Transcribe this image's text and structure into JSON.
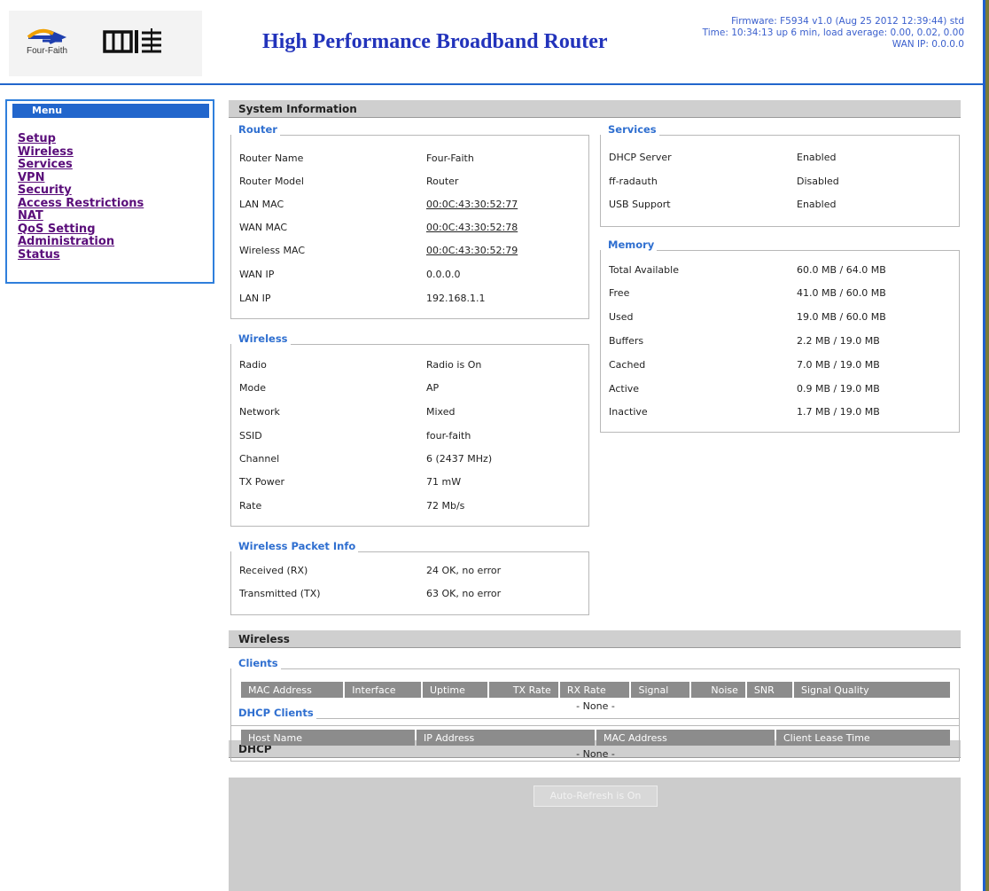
{
  "header": {
    "logo_text": "Four-Faith",
    "title": "High Performance Broadband Router",
    "firmware": "Firmware: F5934 v1.0 (Aug 25 2012 12:39:44) std",
    "time": "Time: 10:34:13 up 6 min, load average: 0.00, 0.02, 0.00",
    "wan_ip": "WAN IP: 0.0.0.0"
  },
  "menu": {
    "title": "Menu",
    "items": [
      "Setup",
      "Wireless",
      "Services",
      "VPN",
      "Security",
      "Access Restrictions",
      "NAT",
      "QoS Setting",
      "Administration",
      "Status"
    ]
  },
  "sections": {
    "system_info": "System Information",
    "wireless": "Wireless",
    "dhcp": "DHCP"
  },
  "router": {
    "legend": "Router",
    "rows": [
      {
        "label": "Router Name",
        "value": "Four-Faith"
      },
      {
        "label": "Router Model",
        "value": "Router"
      },
      {
        "label": "LAN MAC",
        "value": "00:0C:43:30:52:77"
      },
      {
        "label": "WAN MAC",
        "value": "00:0C:43:30:52:78"
      },
      {
        "label": "Wireless MAC",
        "value": "00:0C:43:30:52:79"
      },
      {
        "label": "WAN IP",
        "value": "0.0.0.0"
      },
      {
        "label": "LAN IP",
        "value": "192.168.1.1"
      }
    ]
  },
  "wireless_info": {
    "legend": "Wireless",
    "rows": [
      {
        "label": "Radio",
        "value": "Radio is On"
      },
      {
        "label": "Mode",
        "value": "AP"
      },
      {
        "label": "Network",
        "value": "Mixed"
      },
      {
        "label": "SSID",
        "value": "four-faith"
      },
      {
        "label": "Channel",
        "value": "6 (2437 MHz)"
      },
      {
        "label": "TX Power",
        "value": "71 mW"
      },
      {
        "label": "Rate",
        "value": "72 Mb/s"
      }
    ]
  },
  "packet_info": {
    "legend": "Wireless Packet Info",
    "rows": [
      {
        "label": "Received (RX)",
        "value": "24 OK, no error"
      },
      {
        "label": "Transmitted (TX)",
        "value": "63 OK, no error"
      }
    ]
  },
  "services": {
    "legend": "Services",
    "rows": [
      {
        "label": "DHCP Server",
        "value": "Enabled"
      },
      {
        "label": "ff-radauth",
        "value": "Disabled"
      },
      {
        "label": "USB Support",
        "value": "Enabled"
      }
    ]
  },
  "memory": {
    "legend": "Memory",
    "rows": [
      {
        "label": "Total Available",
        "value": "60.0 MB / 64.0 MB"
      },
      {
        "label": "Free",
        "value": "41.0 MB / 60.0 MB"
      },
      {
        "label": "Used",
        "value": "19.0 MB / 60.0 MB"
      },
      {
        "label": "Buffers",
        "value": "2.2 MB / 19.0 MB"
      },
      {
        "label": "Cached",
        "value": "7.0 MB / 19.0 MB"
      },
      {
        "label": "Active",
        "value": "0.9 MB / 19.0 MB"
      },
      {
        "label": "Inactive",
        "value": "1.7 MB / 19.0 MB"
      }
    ]
  },
  "clients": {
    "legend": "Clients",
    "columns": [
      "MAC Address",
      "Interface",
      "Uptime",
      "TX Rate",
      "RX Rate",
      "Signal",
      "Noise",
      "SNR",
      "Signal Quality"
    ],
    "empty": "- None -"
  },
  "dhcp_clients": {
    "legend": "DHCP Clients",
    "columns": [
      "Host Name",
      "IP Address",
      "MAC Address",
      "Client Lease Time"
    ],
    "empty": "- None -"
  },
  "refresh_button": "Auto-Refresh is On"
}
